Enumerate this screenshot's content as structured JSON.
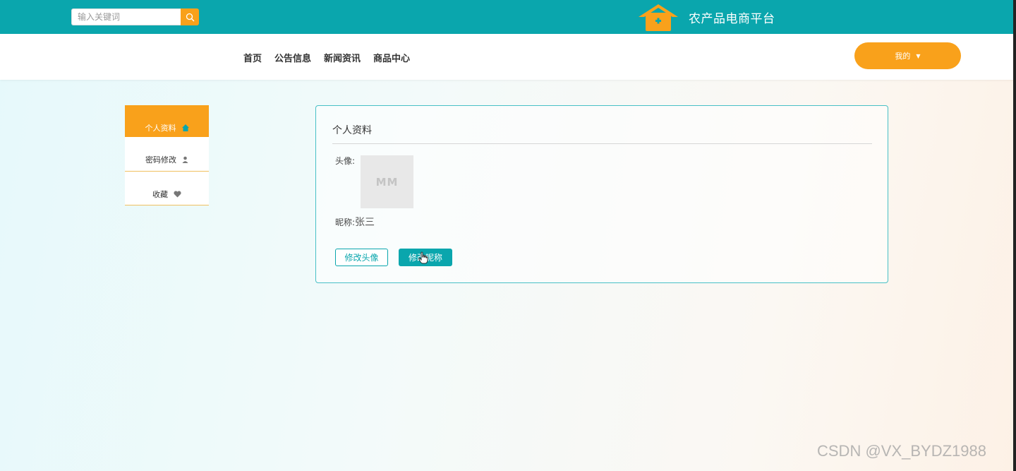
{
  "header": {
    "search": {
      "placeholder": "输入关键词",
      "value": ""
    },
    "site_title": "农产品电商平台",
    "accent_color": "#0aa6ad",
    "brand_orange": "#f9a11b"
  },
  "nav": {
    "items": [
      {
        "label": "首页"
      },
      {
        "label": "公告信息"
      },
      {
        "label": "新闻资讯"
      },
      {
        "label": "商品中心"
      }
    ],
    "user_menu_label": "我的"
  },
  "sidebar": {
    "items": [
      {
        "label": "个人资料",
        "icon": "house-icon",
        "active": true
      },
      {
        "label": "密码修改",
        "icon": "user-icon",
        "active": false
      },
      {
        "label": "收藏",
        "icon": "heart-icon",
        "active": false
      }
    ]
  },
  "profile": {
    "title": "个人资料",
    "avatar_label": "头像:",
    "avatar_placeholder": "MM",
    "nickname_label": "昵称:",
    "nickname_value": "张三",
    "change_avatar_label": "修改头像",
    "change_nickname_label": "修改昵称"
  },
  "watermark": "CSDN @VX_BYDZ1988"
}
